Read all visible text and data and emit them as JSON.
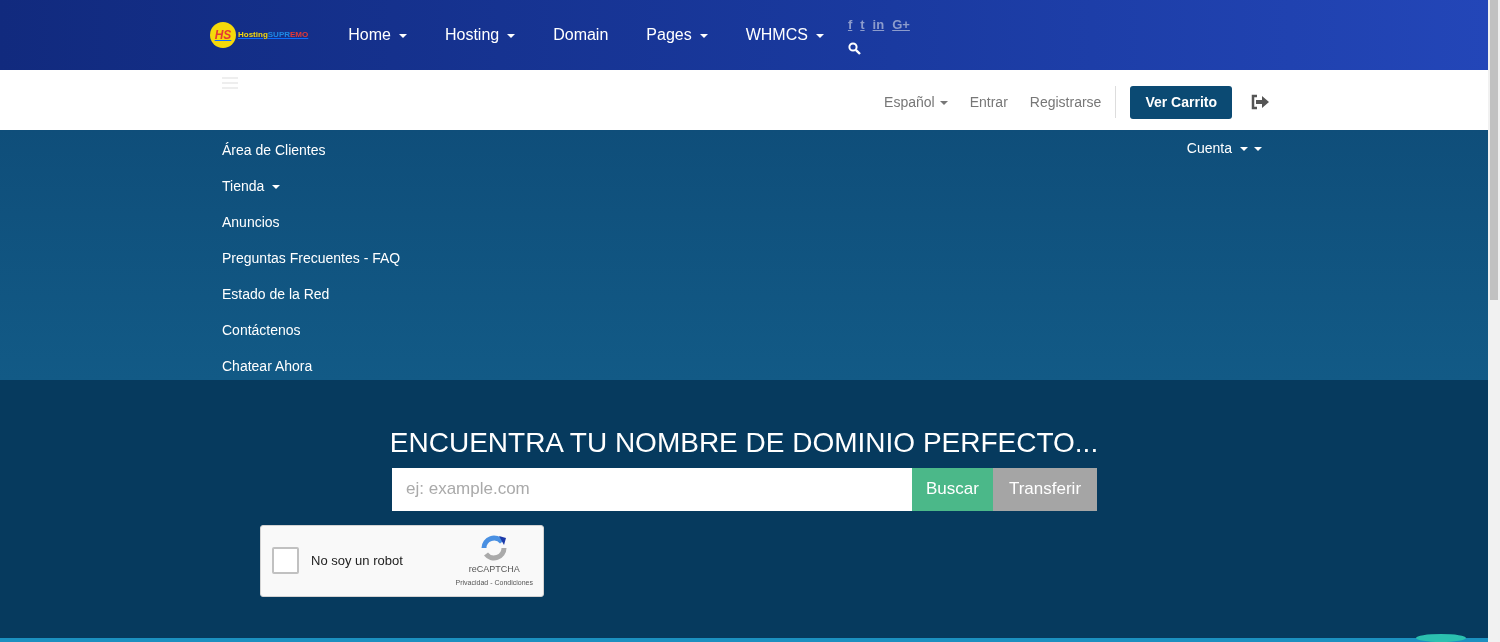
{
  "logo": {
    "badge": "HS",
    "parts": [
      {
        "text": "Hosting",
        "color": "#f5d90a"
      },
      {
        "text": "SUPR",
        "color": "#1e88e5"
      },
      {
        "text": "EMO",
        "color": "#e53935"
      }
    ]
  },
  "top_nav": [
    {
      "label": "Home",
      "dropdown": true
    },
    {
      "label": "Hosting",
      "dropdown": true
    },
    {
      "label": "Domain",
      "dropdown": false
    },
    {
      "label": "Pages",
      "dropdown": true
    },
    {
      "label": "WHMCS",
      "dropdown": true
    }
  ],
  "social": [
    "f",
    "t",
    "in",
    "G+"
  ],
  "utility_bar": {
    "language": "Español",
    "login": "Entrar",
    "register": "Registrarse",
    "cart_button": "Ver Carrito"
  },
  "client_nav": [
    {
      "label": "Área de Clientes",
      "dropdown": false
    },
    {
      "label": "Tienda",
      "dropdown": true
    },
    {
      "label": "Anuncios",
      "dropdown": false
    },
    {
      "label": "Preguntas Frecuentes - FAQ",
      "dropdown": false
    },
    {
      "label": "Estado de la Red",
      "dropdown": false
    },
    {
      "label": "Contáctenos",
      "dropdown": false
    },
    {
      "label": "Chatear Ahora",
      "dropdown": false
    }
  ],
  "account_menu": {
    "label": "Cuenta"
  },
  "domain_search": {
    "heading": "ENCUENTRA TU NOMBRE DE DOMINIO PERFECTO...",
    "placeholder": "ej: example.com",
    "search_button": "Buscar",
    "transfer_button": "Transferir"
  },
  "captcha": {
    "checked": false,
    "label": "No soy un robot",
    "brand": "reCAPTCHA",
    "links": "Privacidad - Condiciones"
  }
}
